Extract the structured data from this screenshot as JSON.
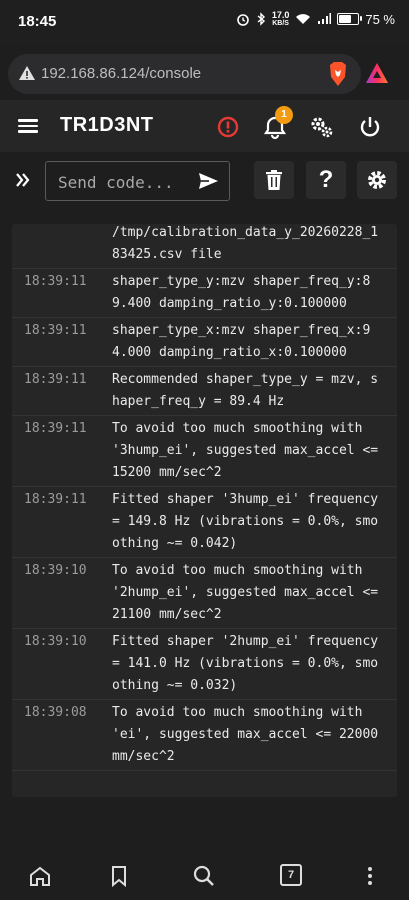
{
  "status_bar": {
    "time": "18:45",
    "net_speed": "17.0",
    "net_unit": "KB/S",
    "battery": "75 %",
    "battery_level": 0.75
  },
  "browser": {
    "url": "192.168.86.124/console",
    "tab_count": "7"
  },
  "app": {
    "title": "TR1D3NT",
    "notification_count": "1",
    "accent_colors": {
      "warning": "#e53935",
      "badge": "#f39c12"
    }
  },
  "command": {
    "placeholder": "Send code..."
  },
  "console": {
    "entries": [
      {
        "time": "",
        "message": "/tmp/calibration_data_y_20260228_183425.csv file"
      },
      {
        "time": "18:39:11",
        "message": "shaper_type_y:mzv shaper_freq_y:89.400 damping_ratio_y:0.100000"
      },
      {
        "time": "18:39:11",
        "message": "shaper_type_x:mzv shaper_freq_x:94.000 damping_ratio_x:0.100000"
      },
      {
        "time": "18:39:11",
        "message": "Recommended shaper_type_y = mzv, shaper_freq_y = 89.4 Hz"
      },
      {
        "time": "18:39:11",
        "message": "To avoid too much smoothing with '3hump_ei', suggested max_accel <= 15200 mm/sec^2"
      },
      {
        "time": "18:39:11",
        "message": "Fitted shaper '3hump_ei' frequency = 149.8 Hz (vibrations = 0.0%, smoothing ~= 0.042)"
      },
      {
        "time": "18:39:10",
        "message": "To avoid too much smoothing with '2hump_ei', suggested max_accel <= 21100 mm/sec^2"
      },
      {
        "time": "18:39:10",
        "message": "Fitted shaper '2hump_ei' frequency = 141.0 Hz (vibrations = 0.0%, smoothing ~= 0.032)"
      },
      {
        "time": "18:39:08",
        "message": "To avoid too much smoothing with 'ei', suggested max_accel <= 22000 mm/sec^2"
      }
    ]
  },
  "icons": {
    "status": [
      "alarm-icon",
      "bluetooth-icon",
      "wifi-icon",
      "signal-icon",
      "battery-icon"
    ],
    "header": [
      "menu-icon",
      "alert-icon",
      "bell-icon",
      "cogs-icon",
      "power-icon"
    ],
    "toolbar": [
      "expand-icon",
      "send-icon",
      "trash-icon",
      "help-icon",
      "settings-icon"
    ],
    "nav": [
      "home-icon",
      "bookmark-icon",
      "search-icon",
      "tabs-icon",
      "more-icon"
    ]
  }
}
